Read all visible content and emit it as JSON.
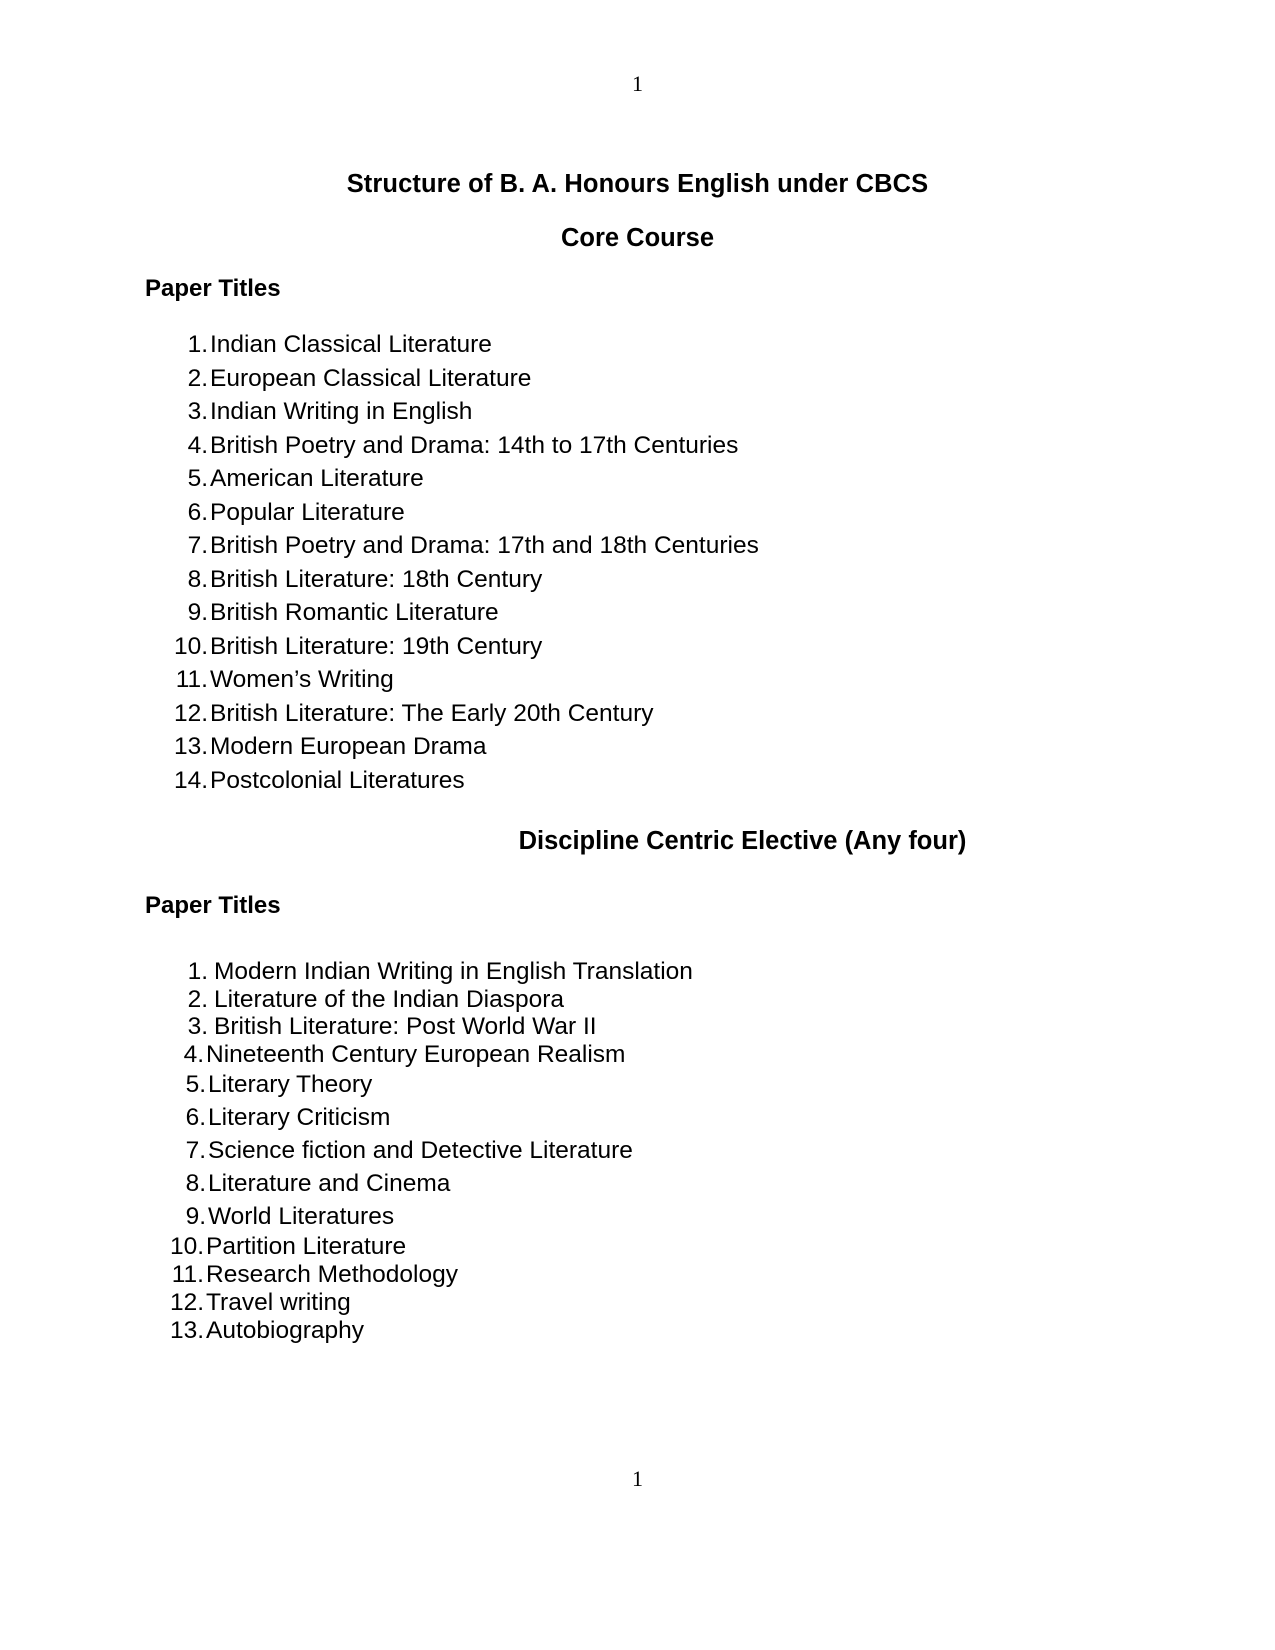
{
  "document": {
    "header_page_number": "1",
    "footer_page_number": "1",
    "title": "Structure of B. A. Honours English under CBCS",
    "subtitle": "Core Course"
  },
  "core_course": {
    "heading": "Paper Titles",
    "papers": [
      {
        "number": "1.",
        "title": "Indian Classical Literature"
      },
      {
        "number": "2.",
        "title": "European Classical Literature"
      },
      {
        "number": "3.",
        "title": "Indian Writing in English"
      },
      {
        "number": "4.",
        "title": "British Poetry and Drama: 14th to 17th Centuries"
      },
      {
        "number": "5.",
        "title": "American Literature"
      },
      {
        "number": "6.",
        "title": "Popular Literature"
      },
      {
        "number": "7.",
        "title": "British Poetry and Drama: 17th and 18th Centuries"
      },
      {
        "number": "8.",
        "title": "British Literature: 18th Century"
      },
      {
        "number": "9.",
        "title": "British Romantic Literature"
      },
      {
        "number": "10.",
        "title": "British Literature: 19th Century"
      },
      {
        "number": "11.",
        "title": "Women’s Writing"
      },
      {
        "number": "12.",
        "title": "British Literature: The Early 20th Century"
      },
      {
        "number": "13.",
        "title": "Modern European Drama"
      },
      {
        "number": "14.",
        "title": "Postcolonial Literatures"
      }
    ]
  },
  "elective": {
    "section_title": "Discipline Centric Elective (Any four)",
    "heading": "Paper Titles",
    "papers": [
      {
        "number": "1.",
        "title": "Modern Indian Writing in English Translation"
      },
      {
        "number": "2.",
        "title": "Literature of the Indian Diaspora"
      },
      {
        "number": "3.",
        "title": "British Literature: Post World War II"
      },
      {
        "number": "4.",
        "title": "Nineteenth Century European Realism"
      },
      {
        "number": "5.",
        "title": "Literary Theory"
      },
      {
        "number": "6.",
        "title": "Literary Criticism"
      },
      {
        "number": "7.",
        "title": "Science fiction and Detective Literature"
      },
      {
        "number": "8.",
        "title": "Literature and Cinema"
      },
      {
        "number": "9.",
        "title": "World Literatures"
      },
      {
        "number": "10.",
        "title": "Partition Literature"
      },
      {
        "number": "11.",
        "title": "Research Methodology"
      },
      {
        "number": "12.",
        "title": "Travel writing"
      },
      {
        "number": "13.",
        "title": "Autobiography"
      }
    ]
  }
}
